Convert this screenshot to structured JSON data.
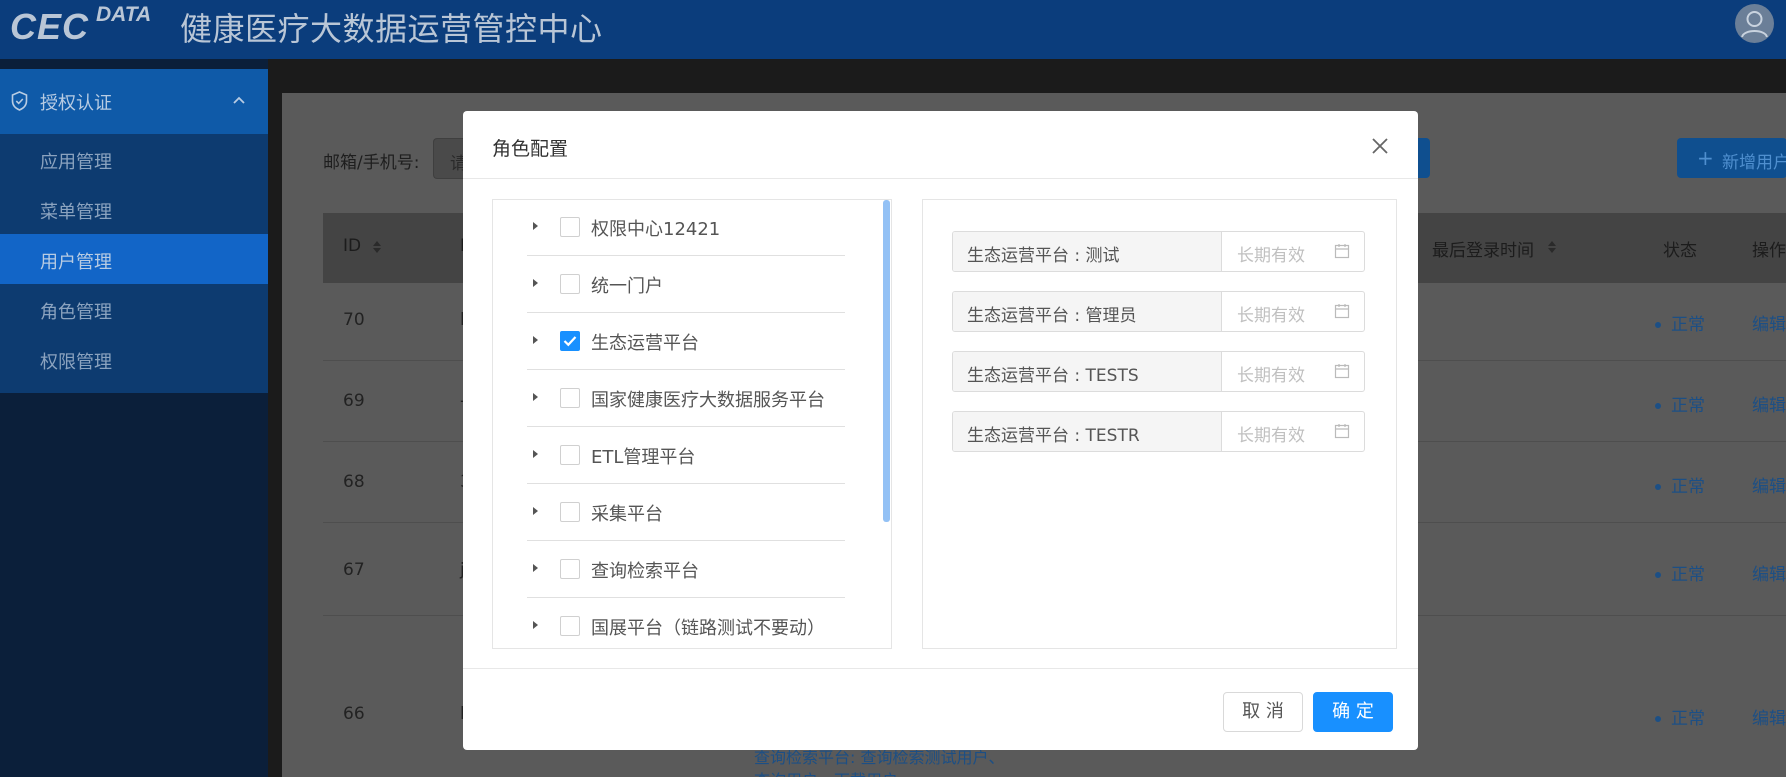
{
  "header": {
    "logo_main": "CEC",
    "logo_sup": "DATA",
    "title": "健康医疗大数据运营管控中心"
  },
  "sidebar": {
    "group_label": "授权认证",
    "items": [
      {
        "label": "应用管理",
        "active": false
      },
      {
        "label": "菜单管理",
        "active": false
      },
      {
        "label": "用户管理",
        "active": true
      },
      {
        "label": "角色管理",
        "active": false
      },
      {
        "label": "权限管理",
        "active": false
      }
    ]
  },
  "filter": {
    "label": "邮箱/手机号:",
    "placeholder": "请",
    "add_button": "新增用户"
  },
  "table": {
    "headers": [
      "ID",
      "最后登录时间",
      "状态",
      "操作"
    ],
    "rows": [
      {
        "id": "70",
        "clip": "l",
        "status": "正常",
        "op": "编辑"
      },
      {
        "id": "69",
        "clip": "-",
        "status": "正常",
        "op": "编辑"
      },
      {
        "id": "68",
        "clip": "3",
        "status": "正常",
        "op": "编辑"
      },
      {
        "id": "67",
        "clip": "j",
        "status": "正常",
        "op": "编辑"
      },
      {
        "id": "66",
        "clip": "l",
        "status": "正常",
        "op": "编辑"
      }
    ],
    "bottom_lines": [
      "查询检索平台: 查询检索测试用户、",
      "查询用户、下载用户"
    ]
  },
  "modal": {
    "title": "角色配置",
    "tree": [
      {
        "label": "权限中心12421",
        "checked": false
      },
      {
        "label": "统一门户",
        "checked": false
      },
      {
        "label": "生态运营平台",
        "checked": true
      },
      {
        "label": "国家健康医疗大数据服务平台",
        "checked": false
      },
      {
        "label": "ETL管理平台",
        "checked": false
      },
      {
        "label": "采集平台",
        "checked": false
      },
      {
        "label": "查询检索平台",
        "checked": false
      },
      {
        "label": "国展平台（链路测试不要动）",
        "checked": false
      }
    ],
    "roles": [
      {
        "name": "生态运营平台 : 测试",
        "placeholder": "长期有效"
      },
      {
        "name": "生态运营平台 : 管理员",
        "placeholder": "长期有效"
      },
      {
        "name": "生态运营平台 : TESTS",
        "placeholder": "长期有效"
      },
      {
        "name": "生态运营平台 : TESTR",
        "placeholder": "长期有效"
      }
    ],
    "cancel_label": "取 消",
    "ok_label": "确 定"
  },
  "colors": {
    "primary": "#1890ff",
    "header_bg": "#0b3d7c",
    "sidebar_active": "#1265c7"
  }
}
